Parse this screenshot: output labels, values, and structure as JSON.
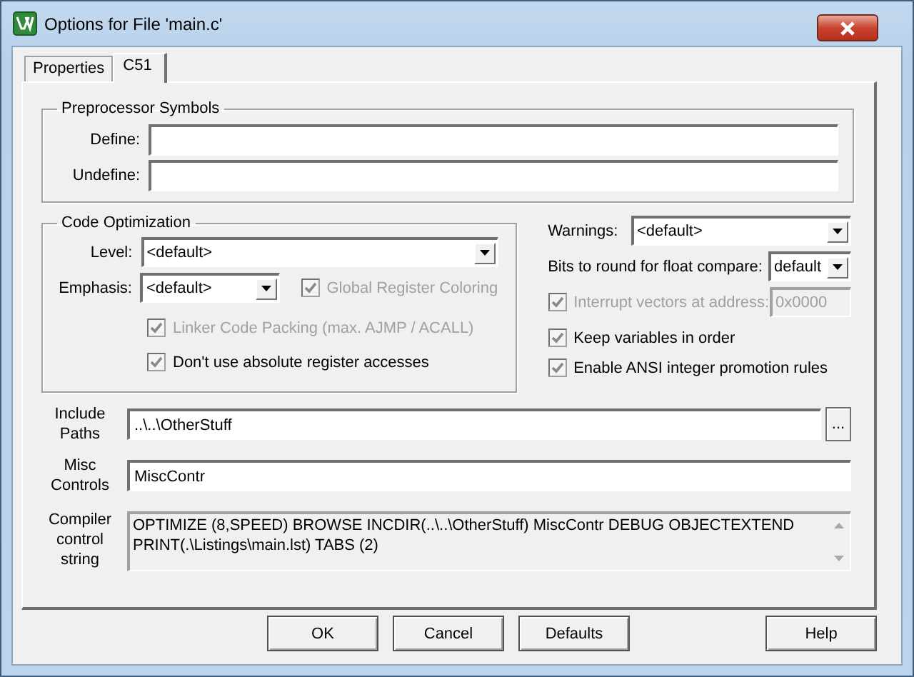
{
  "window": {
    "title": "Options for File 'main.c'"
  },
  "tabs": [
    {
      "label": "Properties",
      "selected": false
    },
    {
      "label": "C51",
      "selected": true
    }
  ],
  "preprocessor": {
    "title": "Preprocessor Symbols",
    "fields": [
      {
        "label": "Define:"
      },
      {
        "label": "Undefine:"
      }
    ]
  },
  "code_optimization": {
    "title": "Code Optimization",
    "level": {
      "label": "Level:",
      "value": "<default>"
    },
    "emphasis": {
      "label": "Emphasis:",
      "value": "<default>"
    },
    "options": [
      {
        "label": "Global Register Coloring",
        "checked": true,
        "disabled": true
      },
      {
        "label": "Linker Code Packing (max. AJMP / ACALL)",
        "checked": true,
        "disabled": true
      },
      {
        "label": "Don't use absolute register accesses",
        "checked": true,
        "disabled": false
      }
    ]
  },
  "warnings": {
    "label": "Warnings:",
    "value": "<default>"
  },
  "float_compare": {
    "label": "Bits to round for float compare:",
    "value": "default"
  },
  "options": [
    {
      "kind": "address",
      "label": "Interrupt vectors at address:",
      "checked": true,
      "disabled": true,
      "address": "0x0000"
    },
    {
      "kind": "checkbox",
      "label": "Keep variables in order",
      "checked": true,
      "disabled": false
    },
    {
      "kind": "checkbox",
      "label": "Enable ANSI integer promotion rules",
      "checked": true,
      "disabled": false
    }
  ],
  "include_paths": {
    "label_lines": [
      "Include",
      "Paths"
    ],
    "value": "..\\..\\OtherStuff",
    "browse": "..."
  },
  "misc_controls": {
    "label_lines": [
      "Misc",
      "Controls"
    ],
    "value": "MiscContr"
  },
  "compiler_control_string": {
    "label_lines": [
      "Compiler",
      "control",
      "string"
    ],
    "lines": [
      "OPTIMIZE (8,SPEED) BROWSE INCDIR(..\\..\\OtherStuff) MiscContr DEBUG OBJECTEXTEND",
      "PRINT(.\\Listings\\main.lst) TABS (2)"
    ]
  },
  "buttons": [
    "OK",
    "Cancel",
    "Defaults"
  ],
  "help_button": "Help"
}
